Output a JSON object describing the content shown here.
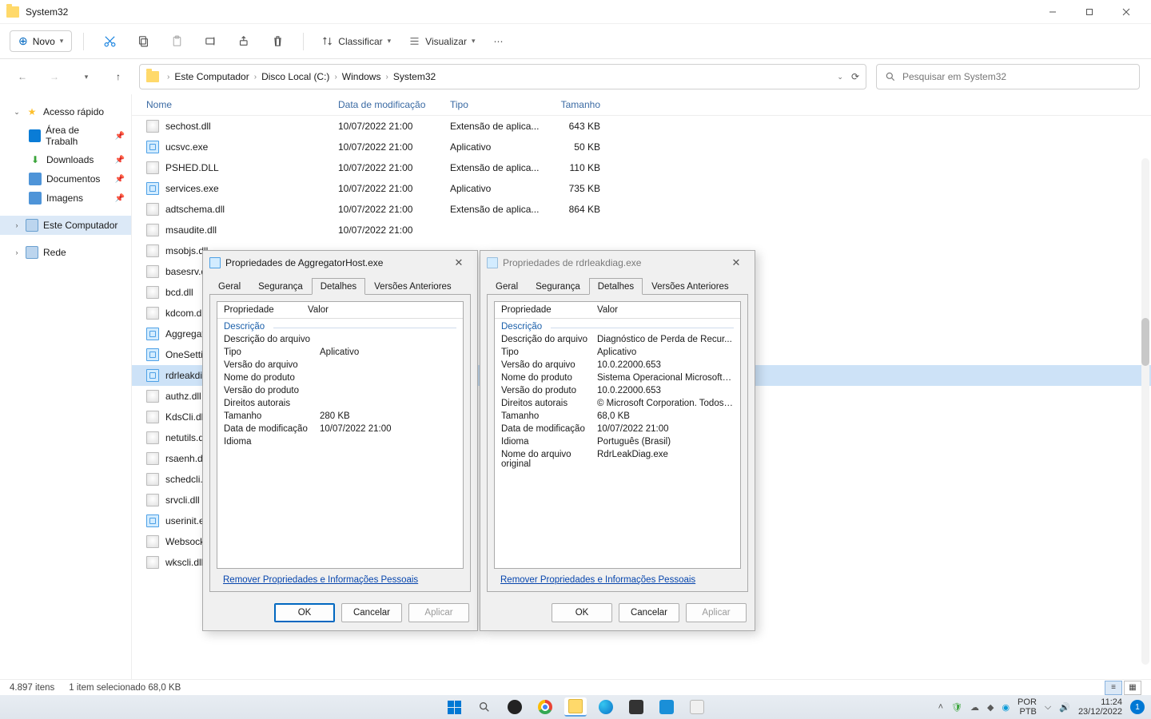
{
  "window": {
    "title": "System32"
  },
  "toolbar": {
    "new_label": "Novo",
    "sort_label": "Classificar",
    "view_label": "Visualizar"
  },
  "breadcrumb": [
    "Este Computador",
    "Disco Local (C:)",
    "Windows",
    "System32"
  ],
  "search": {
    "placeholder": "Pesquisar em System32"
  },
  "sidebar": {
    "quick_access": "Acesso rápido",
    "items": [
      {
        "label": "Área de Trabalh"
      },
      {
        "label": "Downloads"
      },
      {
        "label": "Documentos"
      },
      {
        "label": "Imagens"
      }
    ],
    "this_pc": "Este Computador",
    "network": "Rede"
  },
  "columns": {
    "name": "Nome",
    "date": "Data de modificação",
    "type": "Tipo",
    "size": "Tamanho"
  },
  "files": [
    {
      "name": "sechost.dll",
      "date": "10/07/2022 21:00",
      "type": "Extensão de aplica...",
      "size": "643 KB",
      "icon": "dll"
    },
    {
      "name": "ucsvc.exe",
      "date": "10/07/2022 21:00",
      "type": "Aplicativo",
      "size": "50 KB",
      "icon": "exe"
    },
    {
      "name": "PSHED.DLL",
      "date": "10/07/2022 21:00",
      "type": "Extensão de aplica...",
      "size": "110 KB",
      "icon": "dll"
    },
    {
      "name": "services.exe",
      "date": "10/07/2022 21:00",
      "type": "Aplicativo",
      "size": "735 KB",
      "icon": "exe"
    },
    {
      "name": "adtschema.dll",
      "date": "10/07/2022 21:00",
      "type": "Extensão de aplica...",
      "size": "864 KB",
      "icon": "dll"
    },
    {
      "name": "msaudite.dll",
      "date": "10/07/2022 21:00",
      "type": "",
      "size": "",
      "icon": "dll"
    },
    {
      "name": "msobjs.dll",
      "date": "",
      "type": "",
      "size": "",
      "icon": "dll"
    },
    {
      "name": "basesrv.dll",
      "date": "",
      "type": "",
      "size": "",
      "icon": "dll"
    },
    {
      "name": "bcd.dll",
      "date": "",
      "type": "",
      "size": "",
      "icon": "dll"
    },
    {
      "name": "kdcom.dll",
      "date": "",
      "type": "",
      "size": "",
      "icon": "dll"
    },
    {
      "name": "Aggregator",
      "date": "",
      "type": "",
      "size": "",
      "icon": "exe"
    },
    {
      "name": "OneSettings",
      "date": "",
      "type": "",
      "size": "",
      "icon": "exe"
    },
    {
      "name": "rdrleakdiag.",
      "date": "",
      "type": "",
      "size": "",
      "icon": "exe",
      "selected": true
    },
    {
      "name": "authz.dll",
      "date": "",
      "type": "",
      "size": "",
      "icon": "dll"
    },
    {
      "name": "KdsCli.dll",
      "date": "",
      "type": "",
      "size": "",
      "icon": "dll"
    },
    {
      "name": "netutils.dll",
      "date": "",
      "type": "",
      "size": "",
      "icon": "dll"
    },
    {
      "name": "rsaenh.dll",
      "date": "",
      "type": "",
      "size": "",
      "icon": "dll"
    },
    {
      "name": "schedcli.dll",
      "date": "",
      "type": "",
      "size": "",
      "icon": "dll"
    },
    {
      "name": "srvcli.dll",
      "date": "",
      "type": "",
      "size": "",
      "icon": "dll"
    },
    {
      "name": "userinit.exe",
      "date": "",
      "type": "",
      "size": "",
      "icon": "exe"
    },
    {
      "name": "Websocket.",
      "date": "",
      "type": "",
      "size": "",
      "icon": "dll"
    },
    {
      "name": "wkscli.dll",
      "date": "",
      "type": "",
      "size": "",
      "icon": "dll"
    }
  ],
  "status": {
    "count": "4.897 itens",
    "selection": "1 item selecionado  68,0 KB"
  },
  "dialog1": {
    "title": "Propriedades de AggregatorHost.exe",
    "tabs": [
      "Geral",
      "Segurança",
      "Detalhes",
      "Versões Anteriores"
    ],
    "active_tab": 2,
    "header_prop": "Propriedade",
    "header_val": "Valor",
    "group": "Descrição",
    "rows": [
      {
        "k": "Descrição do arquivo",
        "v": ""
      },
      {
        "k": "Tipo",
        "v": "Aplicativo"
      },
      {
        "k": "Versão do arquivo",
        "v": ""
      },
      {
        "k": "Nome do produto",
        "v": ""
      },
      {
        "k": "Versão do produto",
        "v": ""
      },
      {
        "k": "Direitos autorais",
        "v": ""
      },
      {
        "k": "Tamanho",
        "v": "280 KB"
      },
      {
        "k": "Data de modificação",
        "v": "10/07/2022 21:00"
      },
      {
        "k": "Idioma",
        "v": ""
      }
    ],
    "remove_link": "Remover Propriedades e Informações Pessoais",
    "buttons": {
      "ok": "OK",
      "cancel": "Cancelar",
      "apply": "Aplicar"
    }
  },
  "dialog2": {
    "title": "Propriedades de rdrleakdiag.exe",
    "tabs": [
      "Geral",
      "Segurança",
      "Detalhes",
      "Versões Anteriores"
    ],
    "active_tab": 2,
    "header_prop": "Propriedade",
    "header_val": "Valor",
    "group": "Descrição",
    "rows": [
      {
        "k": "Descrição do arquivo",
        "v": "Diagnóstico de Perda de Recur..."
      },
      {
        "k": "Tipo",
        "v": "Aplicativo"
      },
      {
        "k": "Versão do arquivo",
        "v": "10.0.22000.653"
      },
      {
        "k": "Nome do produto",
        "v": "Sistema Operacional Microsoft®..."
      },
      {
        "k": "Versão do produto",
        "v": "10.0.22000.653"
      },
      {
        "k": "Direitos autorais",
        "v": "© Microsoft Corporation. Todos ..."
      },
      {
        "k": "Tamanho",
        "v": "68,0 KB"
      },
      {
        "k": "Data de modificação",
        "v": "10/07/2022 21:00"
      },
      {
        "k": "Idioma",
        "v": "Português (Brasil)"
      },
      {
        "k": "Nome do arquivo original",
        "v": "RdrLeakDiag.exe"
      }
    ],
    "remove_link": "Remover Propriedades e Informações Pessoais",
    "buttons": {
      "ok": "OK",
      "cancel": "Cancelar",
      "apply": "Aplicar"
    }
  },
  "tray": {
    "lang": "PTB",
    "ime": "POR",
    "time": "11:24",
    "date": "23/12/2022",
    "badge": "1"
  }
}
